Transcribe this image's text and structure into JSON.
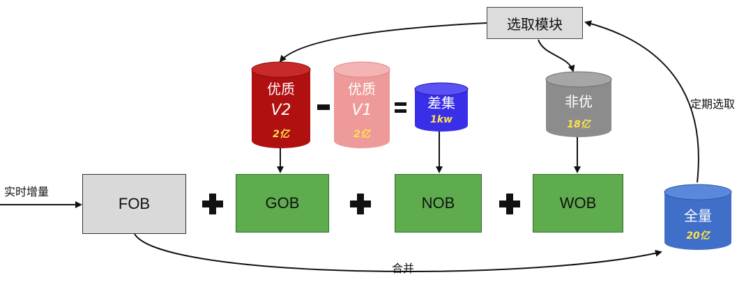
{
  "select_module": {
    "label": "选取模块"
  },
  "periodic_select": {
    "label": "定期选取"
  },
  "realtime_increment": {
    "label": "实时增量"
  },
  "merge": {
    "label": "合并"
  },
  "boxes": {
    "fob": "FOB",
    "gob": "GOB",
    "nob": "NOB",
    "wob": "WOB"
  },
  "cylinders": {
    "quality_v2": {
      "title": "优质",
      "version": "V2",
      "count": "2亿",
      "color": "#b01010"
    },
    "quality_v1": {
      "title": "优质",
      "version": "V1",
      "count": "2亿",
      "color": "#ee9a9a"
    },
    "diff_set": {
      "title": "差集",
      "count": "1kw",
      "color": "#3a2fe8"
    },
    "non_quality": {
      "title": "非优",
      "count": "18亿",
      "color": "#8c8c8c"
    },
    "full": {
      "title": "全量",
      "count": "20亿",
      "color": "#3f6fc8"
    }
  },
  "operators": {
    "minus": "-",
    "equals": "="
  },
  "colors": {
    "green": "#5fac4f",
    "gray_box": "#d9d9d9",
    "count_text": "#ffe14a"
  }
}
